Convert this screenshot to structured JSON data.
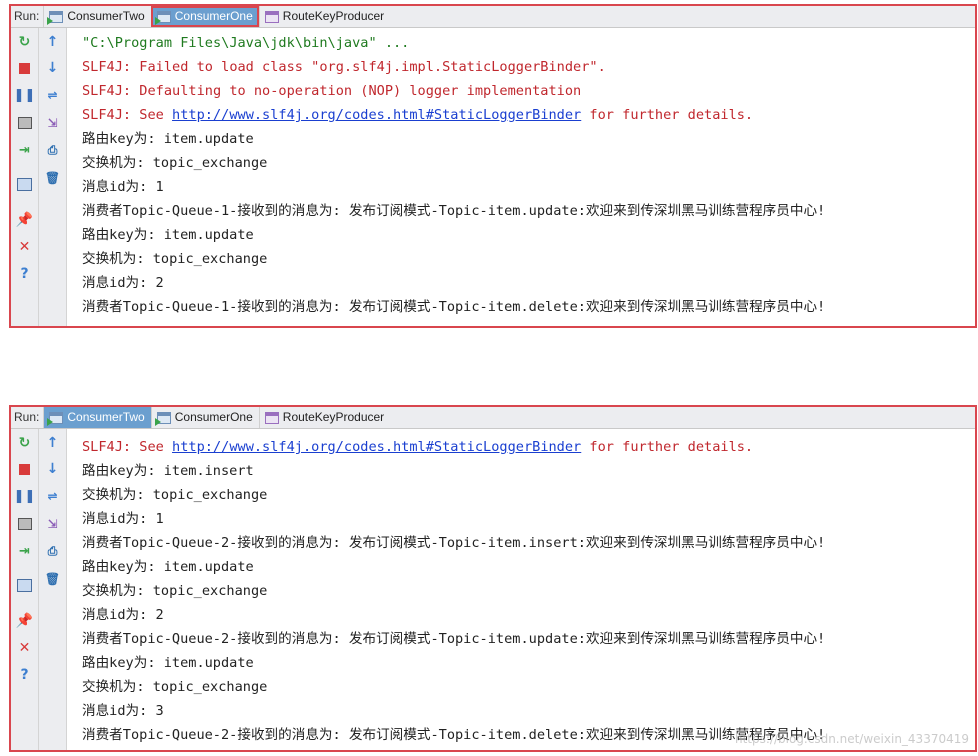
{
  "panels": [
    {
      "run_label": "Run:",
      "tabs": [
        {
          "label": "ConsumerTwo"
        },
        {
          "label": "ConsumerOne"
        },
        {
          "label": "RouteKeyProducer"
        }
      ],
      "selected_tab": "ConsumerOne",
      "lines": [
        "\"C:\\Program Files\\Java\\jdk\\bin\\java\" ...",
        "SLF4J: Failed to load class \"org.slf4j.impl.StaticLoggerBinder\".",
        "SLF4J: Defaulting to no-operation (NOP) logger implementation",
        "SLF4J: See ",
        "路由key为: item.update",
        "交换机为: topic_exchange",
        "消息id为: 1",
        "消费者Topic-Queue-1-接收到的消息为: 发布订阅模式-Topic-item.update:欢迎来到传深圳黑马训练营程序员中心!",
        "路由key为: item.update",
        "交换机为: topic_exchange",
        "消息id为: 2",
        "消费者Topic-Queue-1-接收到的消息为: 发布订阅模式-Topic-item.delete:欢迎来到传深圳黑马训练营程序员中心!"
      ],
      "link_text": "http://www.slf4j.org/codes.html#StaticLoggerBinder",
      "link_suffix": " for further details."
    },
    {
      "run_label": "Run:",
      "tabs": [
        {
          "label": "ConsumerTwo"
        },
        {
          "label": "ConsumerOne"
        },
        {
          "label": "RouteKeyProducer"
        }
      ],
      "selected_tab": "ConsumerTwo",
      "lines": [
        "SLF4J: See ",
        "路由key为: item.insert",
        "交换机为: topic_exchange",
        "消息id为: 1",
        "消费者Topic-Queue-2-接收到的消息为: 发布订阅模式-Topic-item.insert:欢迎来到传深圳黑马训练营程序员中心!",
        "路由key为: item.update",
        "交换机为: topic_exchange",
        "消息id为: 2",
        "消费者Topic-Queue-2-接收到的消息为: 发布订阅模式-Topic-item.update:欢迎来到传深圳黑马训练营程序员中心!",
        "路由key为: item.update",
        "交换机为: topic_exchange",
        "消息id为: 3",
        "消费者Topic-Queue-2-接收到的消息为: 发布订阅模式-Topic-item.delete:欢迎来到传深圳黑马训练营程序员中心!"
      ],
      "link_text": "http://www.slf4j.org/codes.html#StaticLoggerBinder",
      "link_suffix": " for further details."
    }
  ],
  "watermark": "https://blog.csdn.net/weixin_43370419",
  "toolbar_icons": [
    "rerun-icon",
    "stop-icon",
    "pause-icon",
    "dump-threads-icon",
    "restore-layout-icon",
    "settings-icon",
    "pin-icon",
    "close-icon",
    "help-icon"
  ],
  "toolbar_icons_right": [
    "up-arrow-icon",
    "down-arrow-icon",
    "soft-wrap-icon",
    "scroll-to-end-icon",
    "print-icon",
    "clear-icon"
  ],
  "colors": {
    "highlight_border": "#d9464e",
    "selected_tab": "#6b9fcf",
    "error_text": "#c0272d",
    "link": "#1a3fd0",
    "command_text": "#1f7a1f"
  }
}
